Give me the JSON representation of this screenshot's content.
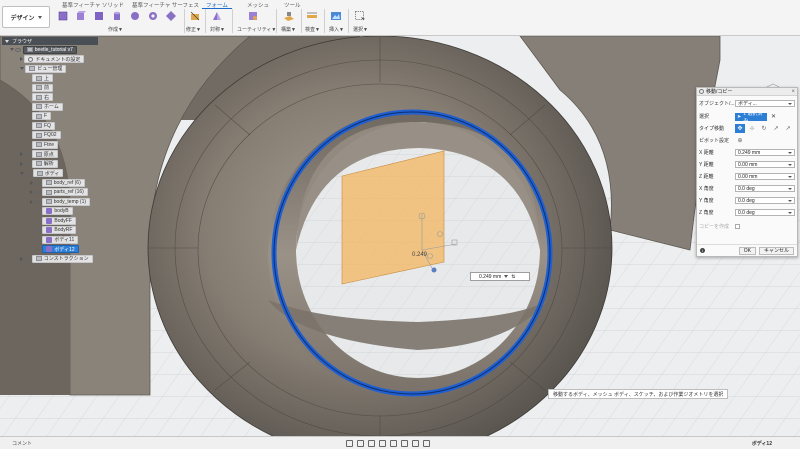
{
  "toolbar": {
    "workspace": "デザイン",
    "tabs": [
      "基準フィーチャ ソリッド",
      "基準フィーチャ サーフェス",
      "フォーム",
      "メッシュ",
      "ツール"
    ],
    "active_tab": "フォーム",
    "groups": [
      "作成▼",
      "修正▼",
      "対称▼",
      "ユーティリティ▼",
      "構築▼",
      "検査▼",
      "挿入▼",
      "選択▼"
    ]
  },
  "browser": {
    "header": "ブラウザ",
    "items": [
      {
        "label": "beetle_tutorial v7"
      },
      {
        "label": "ドキュメントの設定"
      },
      {
        "label": "ビュー管理"
      },
      {
        "label": "上"
      },
      {
        "label": "前"
      },
      {
        "label": "右"
      },
      {
        "label": "ホーム"
      },
      {
        "label": "F"
      },
      {
        "label": "FQ"
      },
      {
        "label": "FQ02"
      },
      {
        "label": "Ftire"
      },
      {
        "label": "原点"
      },
      {
        "label": "解析"
      },
      {
        "label": "ボディ"
      },
      {
        "label": "body_ref (6)"
      },
      {
        "label": "parts_ref (16)"
      },
      {
        "label": "body_temp (1)"
      },
      {
        "label": "bodyB"
      },
      {
        "label": "BodyFF"
      },
      {
        "label": "BodyRF"
      },
      {
        "label": "ボディ11"
      },
      {
        "label": "ボディ12"
      },
      {
        "label": "コンストラクション"
      }
    ]
  },
  "dialog": {
    "title": "移動/コピー",
    "object_label": "オブジェクト/...",
    "object_value": "ボディ...",
    "select_label": "選択",
    "select_value": "1 選択済み",
    "move_type_label": "タイプ移動",
    "pivot_label": "ピボット設定",
    "x_distance_label": "X 距離",
    "x_distance_value": "0.249 mm",
    "y_distance_label": "Y 距離",
    "y_distance_value": "0.00 mm",
    "z_distance_label": "Z 距離",
    "z_distance_value": "0.00 mm",
    "x_angle_label": "X 角度",
    "x_angle_value": "0.0 deg",
    "y_angle_label": "Y 角度",
    "y_angle_value": "0.0 deg",
    "z_angle_label": "Z 角度",
    "z_angle_value": "0.0 deg",
    "copy_label": "コピーを作成",
    "ok": "OK",
    "cancel": "キャンセル"
  },
  "canvas": {
    "manipulator_value": "0.249",
    "distance_input": "0.249 mm",
    "tooltip": "移動するボディ、メッシュ ボディ、スケッチ、および作業ジオメトリを選択"
  },
  "bottom": {
    "comments": "コメント",
    "status": "ボディ12"
  },
  "colors": {
    "accent": "#2d7fd6",
    "ring": "#1f5fd1",
    "plane": "#f4b45a",
    "tire": "#8a8279"
  }
}
